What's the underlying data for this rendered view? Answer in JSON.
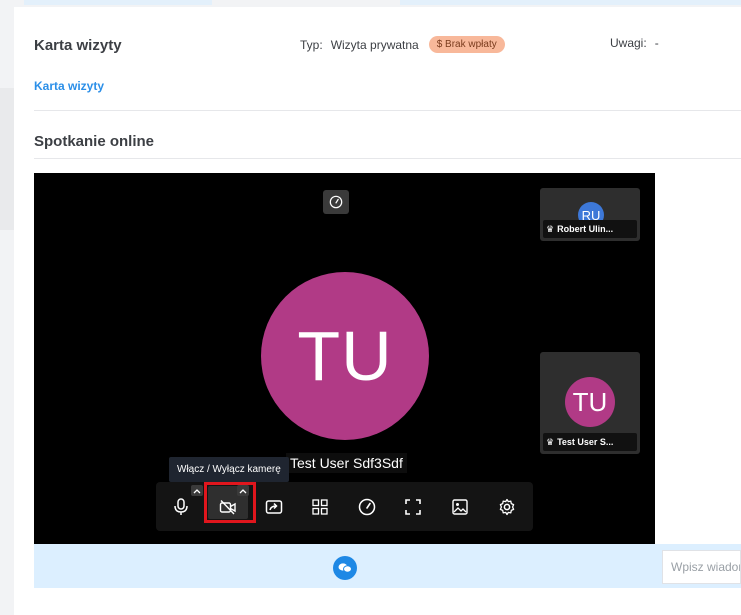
{
  "header": {
    "title": "Karta wizyty",
    "typ_label": "Typ:",
    "typ_value": "Wizyta prywatna",
    "payment_badge": "$ Brak wpłaty",
    "uwagi_label": "Uwagi:",
    "uwagi_value": "-"
  },
  "tabs": [
    {
      "label": "Karta wizyty",
      "active": true
    }
  ],
  "section": {
    "title": "Spotkanie online"
  },
  "video": {
    "main_initials": "TU",
    "main_name": "Test User Sdf3Sdf",
    "tooltip": "Włącz / Wyłącz kamerę",
    "participants": [
      {
        "initials": "RU",
        "name": "Robert Ulin...",
        "avatar_color": "#3d78d8"
      },
      {
        "initials": "TU",
        "name": "Test User S...",
        "avatar_color": "#b13a86"
      }
    ],
    "toolbar": [
      "microphone",
      "camera-off",
      "screen-share",
      "tile-view",
      "performance",
      "fullscreen",
      "background",
      "settings"
    ]
  },
  "chat": {
    "placeholder": "Wpisz wiadom"
  },
  "colors": {
    "accent": "#2b8fe8",
    "highlight": "#e0161d",
    "badge": "#f8b89a",
    "chatbar": "#dcefff"
  }
}
